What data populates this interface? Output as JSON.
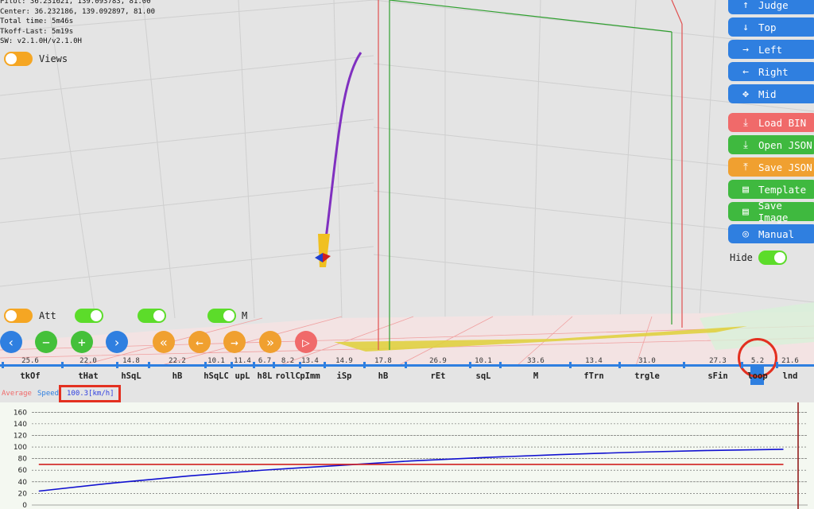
{
  "info": {
    "pilot": "Pilot: 36.231621, 139.093783, 81.00",
    "center": "Center: 36.232186, 139.092897, 81.00",
    "total_time": "Total time: 5m46s",
    "tkoff_last": "Tkoff-Last: 5m19s",
    "sw": "SW: v2.1.0H/v2.1.0H"
  },
  "toggles": {
    "views": {
      "label": "Views",
      "on": false
    },
    "att": {
      "label": "Att",
      "on": false
    },
    "t2": {
      "on": true
    },
    "t3": {
      "on": true
    },
    "m": {
      "label": "M",
      "on": true
    },
    "hide": {
      "label": "Hide",
      "on": true
    }
  },
  "right_buttons": [
    {
      "label": "Judge",
      "icon": "arrow-up-icon",
      "glyph": "↑",
      "color": "#2f7fe0"
    },
    {
      "label": "Top",
      "icon": "arrow-down-icon",
      "glyph": "↓",
      "color": "#2f7fe0"
    },
    {
      "label": "Left",
      "icon": "arrow-right-icon",
      "glyph": "→",
      "color": "#2f7fe0"
    },
    {
      "label": "Right",
      "icon": "arrow-left-icon",
      "glyph": "←",
      "color": "#2f7fe0"
    },
    {
      "label": "Mid",
      "icon": "move-icon",
      "glyph": "✥",
      "color": "#2f7fe0"
    },
    {
      "label": "Load BIN",
      "icon": "download-icon",
      "glyph": "⤓",
      "color": "#f06a6a"
    },
    {
      "label": "Open JSON",
      "icon": "download-icon",
      "glyph": "⤓",
      "color": "#3fb93f"
    },
    {
      "label": "Save JSON",
      "icon": "upload-icon",
      "glyph": "⤒",
      "color": "#f0a030"
    },
    {
      "label": "Template",
      "icon": "document-icon",
      "glyph": "▤",
      "color": "#3fb93f"
    },
    {
      "label": "Save Image",
      "icon": "document-icon",
      "glyph": "▤",
      "color": "#3fb93f"
    },
    {
      "label": "Manual",
      "icon": "lifebuoy-icon",
      "glyph": "◎",
      "color": "#2f7fe0"
    }
  ],
  "controls": [
    {
      "name": "prev-button",
      "icon": "chevron-left-icon",
      "glyph": "‹",
      "style": "cblue"
    },
    {
      "name": "zoom-out-button",
      "icon": "minus-icon",
      "glyph": "−",
      "style": "cgreen"
    },
    {
      "name": "zoom-in-button",
      "icon": "plus-icon",
      "glyph": "+",
      "style": "cgreen"
    },
    {
      "name": "next-button",
      "icon": "chevron-right-icon",
      "glyph": "›",
      "style": "cblue"
    },
    {
      "name": "rewind-button",
      "icon": "double-chevron-left-icon",
      "glyph": "«",
      "style": "corange"
    },
    {
      "name": "step-back-button",
      "icon": "arrow-left-icon",
      "glyph": "←",
      "style": "corange"
    },
    {
      "name": "step-forward-button",
      "icon": "arrow-right-icon",
      "glyph": "→",
      "style": "corange"
    },
    {
      "name": "fast-forward-button",
      "icon": "double-chevron-right-icon",
      "glyph": "»",
      "style": "corange"
    },
    {
      "name": "play-button",
      "icon": "play-icon",
      "glyph": "▷",
      "style": "cred"
    }
  ],
  "timeline": {
    "segments": [
      {
        "label": "tkOf",
        "value": "25.6"
      },
      {
        "label": "tHat",
        "value": "22.0"
      },
      {
        "label": "hSqL",
        "value": "14.8"
      },
      {
        "label": "hB",
        "value": "22.2"
      },
      {
        "label": "hSqLC",
        "value": "10.1"
      },
      {
        "label": "upL",
        "value": "11.4"
      },
      {
        "label": "h8L",
        "value": "6.7"
      },
      {
        "label": "rollC",
        "value": "8.2"
      },
      {
        "label": "pImm",
        "value": "13.4"
      },
      {
        "label": "iSp",
        "value": "14.9"
      },
      {
        "label": "hB",
        "value": "17.8"
      },
      {
        "label": "rEt",
        "value": "26.9"
      },
      {
        "label": "sqL",
        "value": "10.1"
      },
      {
        "label": "M",
        "value": "33.6"
      },
      {
        "label": "fTrn",
        "value": "13.4"
      },
      {
        "label": "trgle",
        "value": "31.0"
      },
      {
        "label": "sFin",
        "value": "27.3"
      },
      {
        "label": "loop",
        "value": "5.2"
      },
      {
        "label": "lnd",
        "value": "21.6"
      }
    ]
  },
  "speed": {
    "average_label": "Average",
    "speed_label": "Speed",
    "value": "100.3[km/h]"
  },
  "chart_data": {
    "type": "line",
    "y_ticks": [
      0,
      20,
      40,
      60,
      80,
      100,
      120,
      140,
      160
    ],
    "ylim": [
      0,
      170
    ],
    "xlim": [
      0,
      1
    ],
    "grid": true,
    "series": [
      {
        "color": "#1010d0",
        "x": [
          0.0,
          0.1,
          0.2,
          0.3,
          0.4,
          0.5,
          0.6,
          0.7,
          0.8,
          0.9,
          1.0
        ],
        "y": [
          24,
          38,
          50,
          60,
          68,
          76,
          82,
          87,
          91,
          94,
          96
        ]
      },
      {
        "color": "#d02020",
        "x": [
          0.0,
          1.0
        ],
        "y": [
          70,
          70
        ]
      }
    ],
    "marker_x": 1.0
  }
}
